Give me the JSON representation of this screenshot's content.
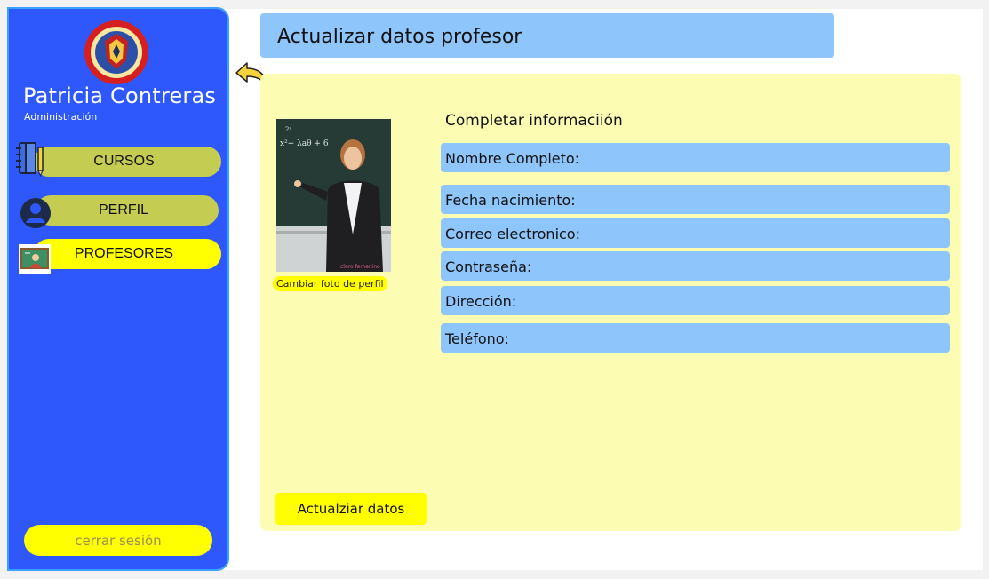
{
  "sidebar": {
    "logo_alt": "COLEGIO SAN PEDRO CLAVER BUCARAMANGA",
    "user_name": "Patricia Contreras",
    "user_role": "Administración",
    "nav": [
      {
        "label": "CURSOS",
        "icon": "notebook-icon"
      },
      {
        "label": "PERFIL",
        "icon": "user-icon"
      },
      {
        "label": "PROFESORES",
        "icon": "teacher-icon"
      }
    ],
    "logout_label": "cerrar sesión",
    "active_item": "PROFESORES"
  },
  "header": {
    "title": "Actualizar datos profesor"
  },
  "main": {
    "photo_watermark": "claro femenino",
    "change_photo_label": "Cambiar foto de perfil",
    "section_title": "Completar informaciión",
    "fields": [
      {
        "label": "Nombre Completo:",
        "value": ""
      },
      {
        "label": "Fecha nacimiento:",
        "value": ""
      },
      {
        "label": "Correo electronico:",
        "value": ""
      },
      {
        "label": "Contraseña:",
        "value": ""
      },
      {
        "label": "Dirección:",
        "value": ""
      },
      {
        "label": "Teléfono:",
        "value": ""
      }
    ],
    "submit_label": "Actualziar datos"
  },
  "colors": {
    "sidebar_bg": "#2e58fb",
    "nav_pill": "#c4cc52",
    "nav_active": "#ffff00",
    "header_bg": "#8ec5fb",
    "panel_bg": "#fcfdb2",
    "field_bg": "#8ec5fb",
    "button_bg": "#ffff00"
  }
}
